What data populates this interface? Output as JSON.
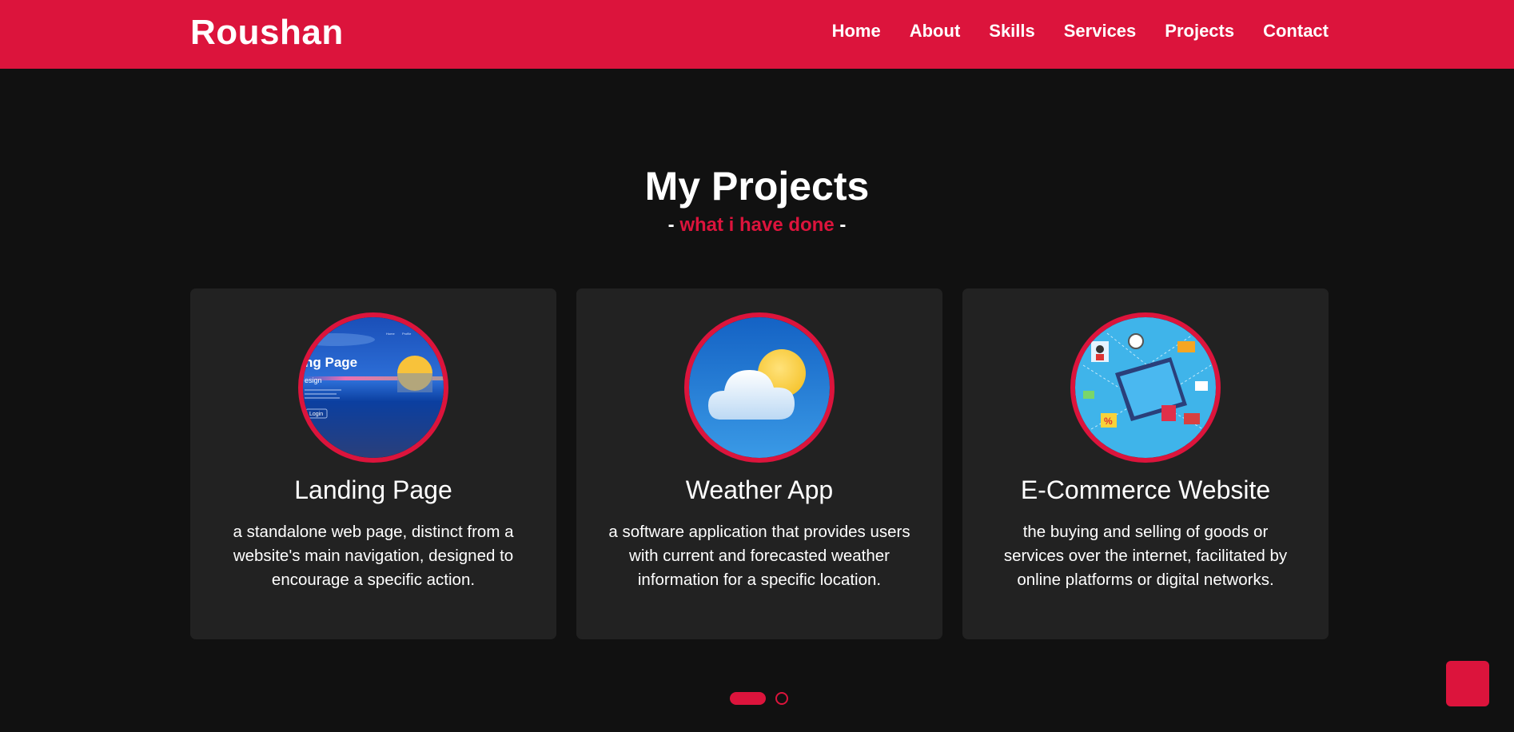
{
  "navbar": {
    "logo": "Roushan",
    "menu": [
      "Home",
      "About",
      "Skills",
      "Services",
      "Projects",
      "Contact"
    ]
  },
  "section": {
    "title": "My Projects",
    "subtitle_left": "-",
    "subtitle_accent": "what i have done",
    "subtitle_right": "-"
  },
  "projects": [
    {
      "title": "Landing Page",
      "description": "a standalone web page, distinct from a website's main navigation, designed to encourage a specific action.",
      "thumb_text": {
        "heading": "ng Page",
        "sub": "esign",
        "button": "Login",
        "nav_left": "Home",
        "nav_right": "Profile"
      }
    },
    {
      "title": "Weather App",
      "description": "a software application that provides users with current and forecasted weather information for a specific location."
    },
    {
      "title": "E-Commerce Website",
      "description": "the buying and selling of goods or services over the internet, facilitated by online platforms or digital networks."
    }
  ],
  "colors": {
    "accent": "#dc143c",
    "background": "#111111",
    "card": "#222222"
  },
  "carousel": {
    "pages": 2,
    "active": 1
  },
  "icons": {
    "scroll_button": "scroll-top-icon"
  }
}
